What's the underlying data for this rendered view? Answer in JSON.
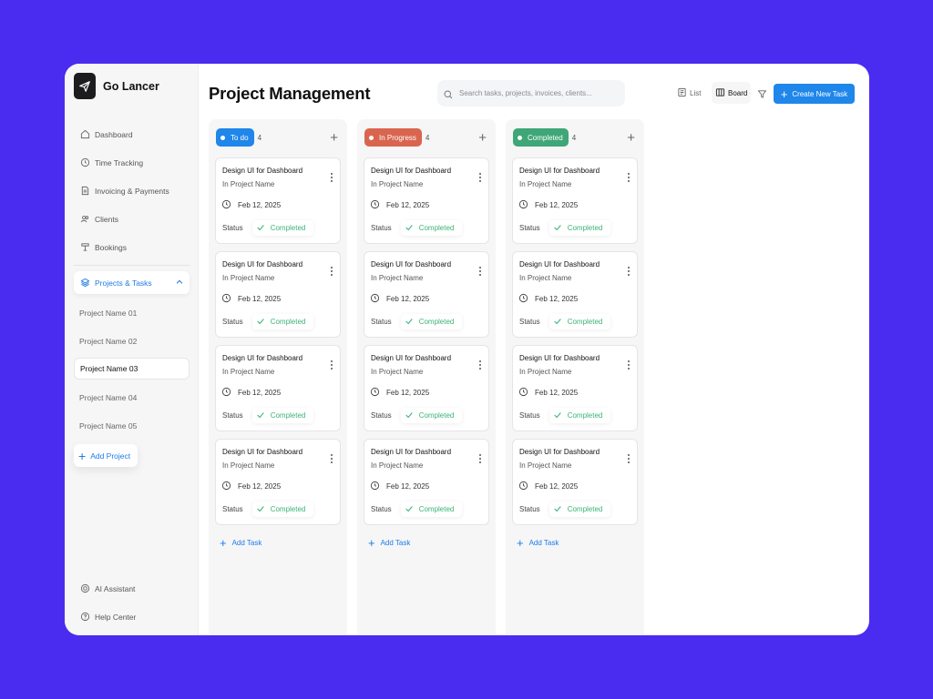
{
  "brand": {
    "name": "Go Lancer"
  },
  "sidebar": {
    "items": [
      {
        "label": "Dashboard",
        "icon": "home-icon"
      },
      {
        "label": "Time Tracking",
        "icon": "clock-icon"
      },
      {
        "label": "Invoicing & Payments",
        "icon": "invoice-icon"
      },
      {
        "label": "Clients",
        "icon": "clients-icon"
      },
      {
        "label": "Bookings",
        "icon": "bookings-icon"
      }
    ],
    "projects_group": {
      "label": "Projects & Tasks",
      "icon": "layers-icon"
    },
    "projects": [
      "Project Name 01",
      "Project Name 02",
      "Project Name 03",
      "Project Name 04",
      "Project Name 05"
    ],
    "selected_project": "Project Name 03",
    "add_project": "Add Project",
    "bottom_items": [
      {
        "label": "AI Assistant",
        "icon": "ai-icon"
      },
      {
        "label": "Help Center",
        "icon": "help-icon"
      }
    ]
  },
  "header": {
    "title": "Project Management",
    "search_placeholder": "Search tasks, projects, invoices, clients...",
    "view_list": "List",
    "view_board": "Board",
    "create_button": "Create New Task"
  },
  "columns": [
    {
      "label": "To do",
      "count": "4",
      "color": "#1f86ea",
      "cards": [
        {
          "title": "Design UI for Dashboard",
          "subtitle": "In Project Name",
          "date": "Feb 12, 2025",
          "status_label": "Status",
          "status": "Completed"
        },
        {
          "title": "Design UI for Dashboard",
          "subtitle": "In Project Name",
          "date": "Feb 12, 2025",
          "status_label": "Status",
          "status": "Completed"
        },
        {
          "title": "Design UI for Dashboard",
          "subtitle": "In Project Name",
          "date": "Feb 12, 2025",
          "status_label": "Status",
          "status": "Completed"
        },
        {
          "title": "Design UI for Dashboard",
          "subtitle": "In Project Name",
          "date": "Feb 12, 2025",
          "status_label": "Status",
          "status": "Completed"
        }
      ],
      "add_task": "Add Task"
    },
    {
      "label": "In Progress",
      "count": "4",
      "color": "#d9654f",
      "cards": [
        {
          "title": "Design UI for Dashboard",
          "subtitle": "In Project Name",
          "date": "Feb 12, 2025",
          "status_label": "Status",
          "status": "Completed"
        },
        {
          "title": "Design UI for Dashboard",
          "subtitle": "In Project Name",
          "date": "Feb 12, 2025",
          "status_label": "Status",
          "status": "Completed"
        },
        {
          "title": "Design UI for Dashboard",
          "subtitle": "In Project Name",
          "date": "Feb 12, 2025",
          "status_label": "Status",
          "status": "Completed"
        },
        {
          "title": "Design UI for Dashboard",
          "subtitle": "In Project Name",
          "date": "Feb 12, 2025",
          "status_label": "Status",
          "status": "Completed"
        }
      ],
      "add_task": "Add Task"
    },
    {
      "label": "Completed",
      "count": "4",
      "color": "#3fa677",
      "cards": [
        {
          "title": "Design UI for Dashboard",
          "subtitle": "In Project Name",
          "date": "Feb 12, 2025",
          "status_label": "Status",
          "status": "Completed"
        },
        {
          "title": "Design UI for Dashboard",
          "subtitle": "In Project Name",
          "date": "Feb 12, 2025",
          "status_label": "Status",
          "status": "Completed"
        },
        {
          "title": "Design UI for Dashboard",
          "subtitle": "In Project Name",
          "date": "Feb 12, 2025",
          "status_label": "Status",
          "status": "Completed"
        },
        {
          "title": "Design UI for Dashboard",
          "subtitle": "In Project Name",
          "date": "Feb 12, 2025",
          "status_label": "Status",
          "status": "Completed"
        }
      ],
      "add_task": "Add Task"
    }
  ],
  "colors": {
    "background": "#4a2bf0",
    "accent": "#1f86ea",
    "success": "#3bb377"
  }
}
